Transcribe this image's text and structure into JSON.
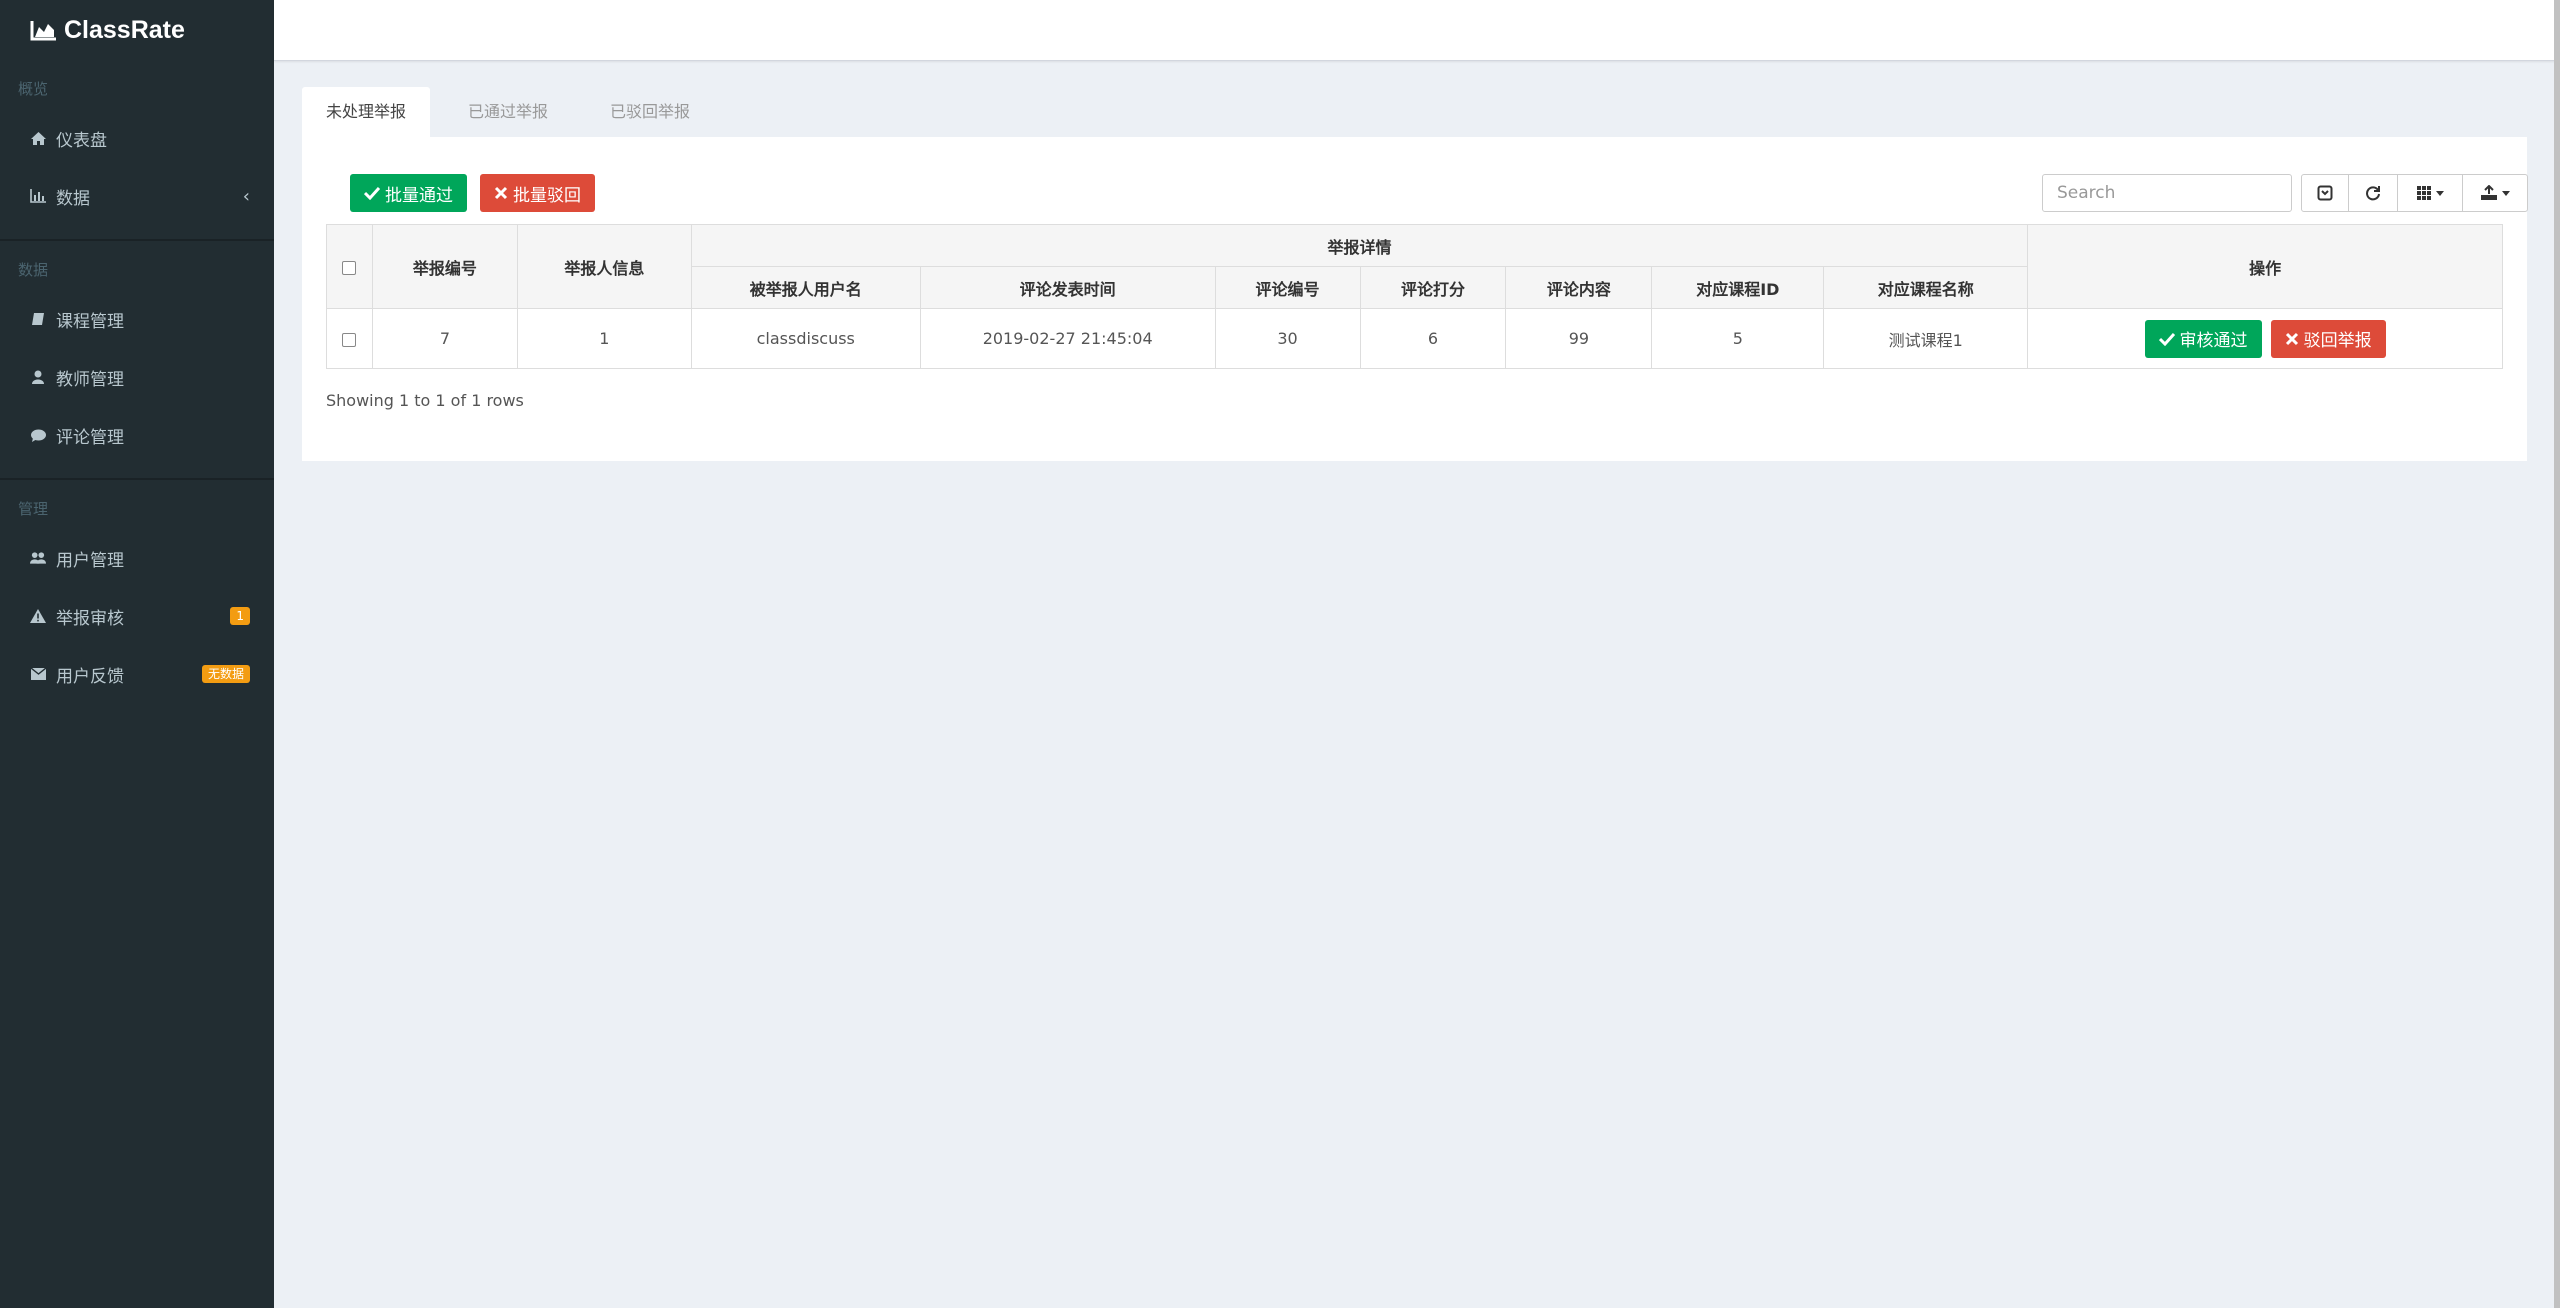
{
  "app": {
    "title": "ClassRate"
  },
  "sidebar": {
    "sections": [
      {
        "header": "概览"
      },
      {
        "header": "数据"
      },
      {
        "header": "管理"
      }
    ],
    "items": [
      {
        "label": "仪表盘",
        "icon": "home-icon"
      },
      {
        "label": "数据",
        "icon": "bar-chart-icon"
      },
      {
        "label": "课程管理",
        "icon": "book-icon"
      },
      {
        "label": "教师管理",
        "icon": "user-icon"
      },
      {
        "label": "评论管理",
        "icon": "comment-icon"
      },
      {
        "label": "用户管理",
        "icon": "users-icon"
      },
      {
        "label": "举报审核",
        "icon": "warning-icon",
        "badge": "1"
      },
      {
        "label": "用户反馈",
        "icon": "envelope-icon",
        "badge": "无数据"
      }
    ],
    "chevron": "‹"
  },
  "tabs": [
    {
      "label": "未处理举报",
      "active": true
    },
    {
      "label": "已通过举报",
      "active": false
    },
    {
      "label": "已驳回举报",
      "active": false
    }
  ],
  "toolbar": {
    "batch_approve": "批量通过",
    "batch_reject": "批量驳回",
    "search_placeholder": "Search"
  },
  "table": {
    "group_header": "举报详情",
    "headers": {
      "report_id": "举报编号",
      "reporter": "举报人信息",
      "reported_user": "被举报人用户名",
      "comment_time": "评论发表时间",
      "comment_id": "评论编号",
      "score": "评论打分",
      "content": "评论内容",
      "course_id": "对应课程ID",
      "course_name": "对应课程名称",
      "actions": "操作"
    },
    "rows": [
      {
        "report_id": "7",
        "reporter": "1",
        "reported_user": "classdiscuss",
        "comment_time": "2019-02-27 21:45:04",
        "comment_id": "30",
        "score": "6",
        "content": "99",
        "course_id": "5",
        "course_name": "测试课程1",
        "approve_label": "审核通过",
        "reject_label": "驳回举报"
      }
    ],
    "footer": "Showing 1 to 1 of 1 rows"
  },
  "colors": {
    "sidebar_bg": "#222d32",
    "green": "#00a65a",
    "red": "#dd4b39",
    "badge": "#f39c12"
  }
}
